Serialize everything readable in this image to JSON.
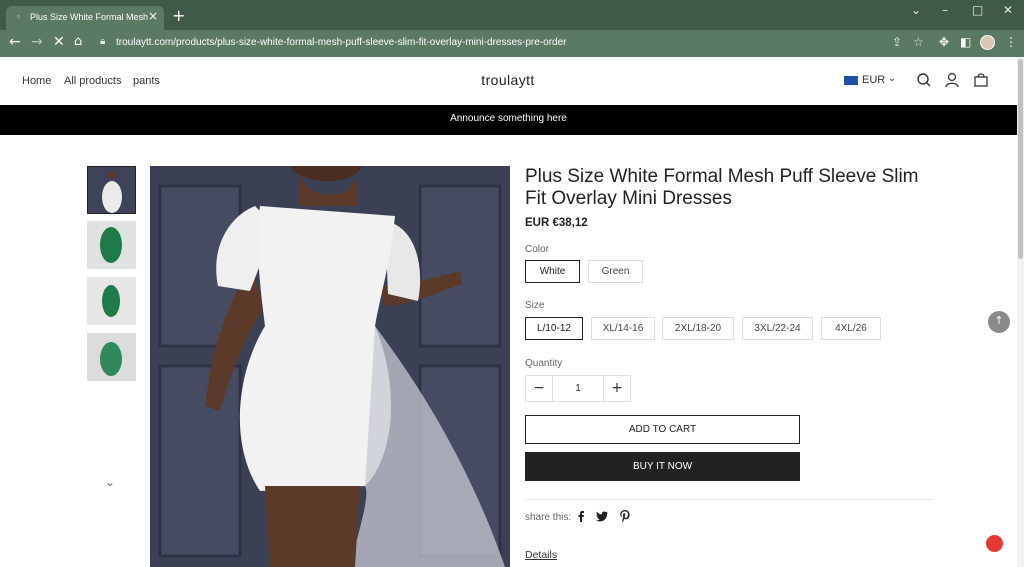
{
  "browser": {
    "tab_title": "Plus Size White Formal Mesh Puff",
    "url": "troulaytt.com/products/plus-size-white-formal-mesh-puff-sleeve-slim-fit-overlay-mini-dresses-pre-order",
    "icons": [
      "back-icon",
      "forward-icon",
      "stop-icon",
      "home-icon",
      "lock-icon",
      "share-icon",
      "star-icon",
      "puzzle-icon",
      "sidebar-icon",
      "menu-icon"
    ]
  },
  "header": {
    "nav": [
      "Home",
      "All products",
      "pants"
    ],
    "brand": "troulaytt",
    "currency": "EUR"
  },
  "announcement": "Announce something here",
  "product": {
    "title": "Plus Size White Formal Mesh Puff Sleeve Slim Fit Overlay Mini Dresses",
    "price": "EUR €38,12",
    "color_label": "Color",
    "colors": [
      "White",
      "Green"
    ],
    "selected_color": "White",
    "size_label": "Size",
    "sizes": [
      "L/10-12",
      "XL/14-16",
      "2XL/18-20",
      "3XL/22-24",
      "4XL/26"
    ],
    "selected_size": "L/10-12",
    "quantity_label": "Quantity",
    "quantity": "1",
    "add_to_cart": "ADD TO CART",
    "buy_now": "BUY IT NOW",
    "share_label": "share this:",
    "details": "Details"
  },
  "colors": {
    "chrome": "#3f5a48",
    "chrome_bar": "#5a7a64",
    "announce_bg": "#000000",
    "buy_now_bg": "#222222",
    "chat": "#e53935"
  }
}
